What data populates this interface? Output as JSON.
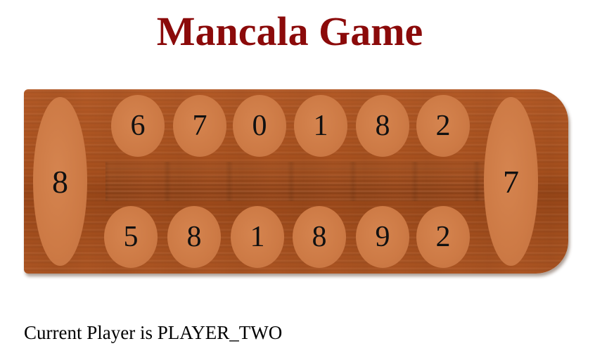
{
  "title": "Mancala Game",
  "colors": {
    "title": "#8b0a0a",
    "board_wood": "#a8501d",
    "pit": "#cd7a45"
  },
  "board": {
    "store_left": "8",
    "store_right": "7",
    "top_row": [
      "6",
      "7",
      "0",
      "1",
      "8",
      "2"
    ],
    "bottom_row": [
      "5",
      "8",
      "1",
      "8",
      "9",
      "2"
    ]
  },
  "status": {
    "current_player": "Current Player is PLAYER_TWO"
  }
}
